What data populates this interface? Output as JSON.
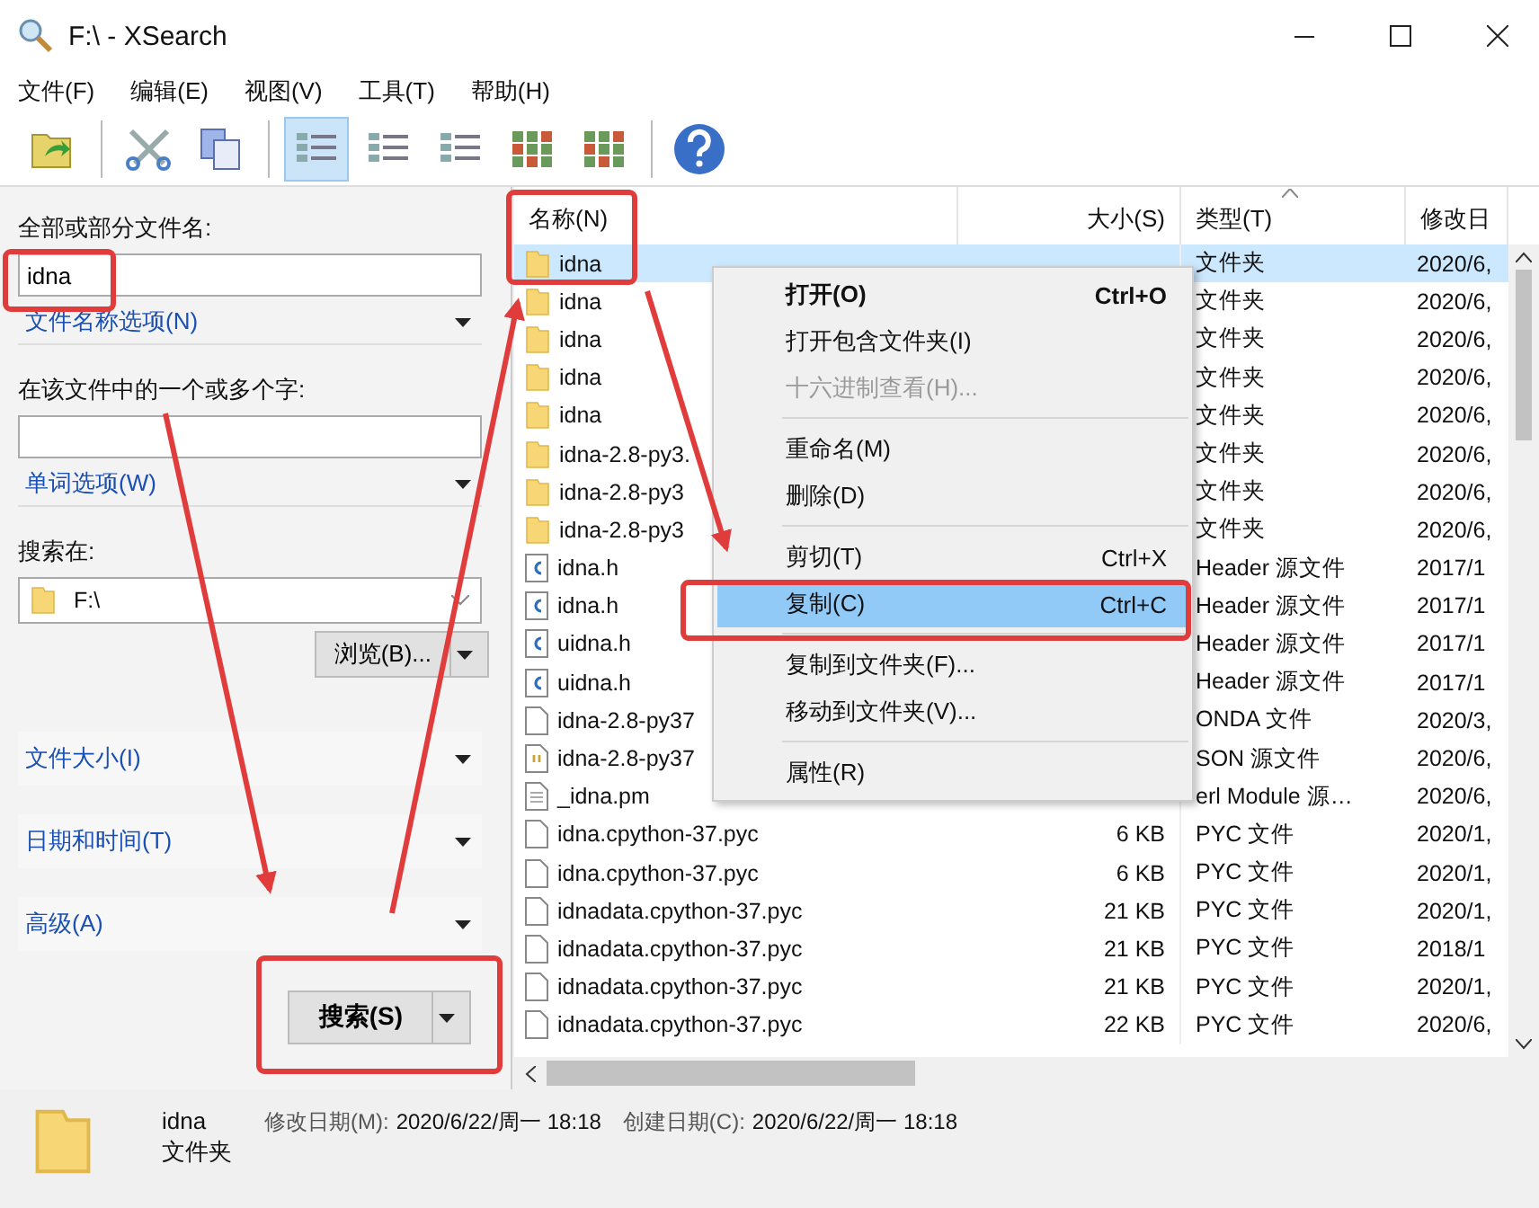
{
  "window": {
    "title": "F:\\ - XSearch"
  },
  "menu_bar": [
    "文件(F)",
    "编辑(E)",
    "视图(V)",
    "工具(T)",
    "帮助(H)"
  ],
  "toolbar": [
    {
      "kind": "open",
      "selected": false
    },
    {
      "kind": "separator"
    },
    {
      "kind": "cut",
      "selected": false
    },
    {
      "kind": "copy",
      "selected": false
    },
    {
      "kind": "separator"
    },
    {
      "kind": "details",
      "selected": true
    },
    {
      "kind": "list",
      "selected": false
    },
    {
      "kind": "tiles",
      "selected": false
    },
    {
      "kind": "icons",
      "selected": false
    },
    {
      "kind": "thumbnails",
      "selected": false
    },
    {
      "kind": "separator"
    },
    {
      "kind": "help",
      "selected": false
    }
  ],
  "search_panel": {
    "filename_label": "全部或部分文件名:",
    "filename_value": "idna",
    "filename_options": "文件名称选项(N)",
    "words_label": "在该文件中的一个或多个字:",
    "word_options": "单词选项(W)",
    "search_in_label": "搜索在:",
    "search_in_value": "F:\\",
    "browse_button": "浏览(B)...",
    "sections": [
      "文件大小(I)",
      "日期和时间(T)",
      "高级(A)"
    ],
    "search_button": "搜索(S)"
  },
  "table": {
    "columns": [
      "名称(N)",
      "大小(S)",
      "类型(T)",
      "修改日"
    ],
    "rows": [
      {
        "kind": "folder",
        "name": "idna",
        "type": "文件夹",
        "modified": "2020/6,",
        "selected": true
      },
      {
        "kind": "folder",
        "name": "idna",
        "type": "文件夹",
        "modified": "2020/6,",
        "selected": false
      },
      {
        "kind": "folder",
        "name": "idna",
        "type": "文件夹",
        "modified": "2020/6,",
        "selected": false
      },
      {
        "kind": "folder",
        "name": "idna",
        "type": "文件夹",
        "modified": "2020/6,",
        "selected": false
      },
      {
        "kind": "folder",
        "name": "idna",
        "type": "文件夹",
        "modified": "2020/6,",
        "selected": false
      },
      {
        "kind": "folder",
        "name": "idna-2.8-py3.",
        "type": "文件夹",
        "modified": "2020/6,",
        "selected": false
      },
      {
        "kind": "folder",
        "name": "idna-2.8-py3",
        "type": "文件夹",
        "modified": "2020/6,",
        "selected": false
      },
      {
        "kind": "folder",
        "name": "idna-2.8-py3",
        "type": "文件夹",
        "modified": "2020/6,",
        "selected": false
      },
      {
        "kind": "c",
        "name": "idna.h",
        "type": "Header 源文件",
        "modified": "2017/1",
        "selected": false
      },
      {
        "kind": "c",
        "name": "idna.h",
        "type": "Header 源文件",
        "modified": "2017/1",
        "selected": false
      },
      {
        "kind": "c",
        "name": "uidna.h",
        "type": "Header 源文件",
        "modified": "2017/1",
        "selected": false
      },
      {
        "kind": "c",
        "name": "uidna.h",
        "type": "Header 源文件",
        "modified": "2017/1",
        "selected": false
      },
      {
        "kind": "blank",
        "name": "idna-2.8-py37",
        "type": "ONDA 文件",
        "modified": "2020/3,",
        "selected": false
      },
      {
        "kind": "json",
        "name": "idna-2.8-py37",
        "type": "SON 源文件",
        "modified": "2020/6,",
        "selected": false
      },
      {
        "kind": "text",
        "name": "_idna.pm",
        "type": "erl Module 源…",
        "modified": "2020/6,",
        "selected": false
      },
      {
        "kind": "blank",
        "name": "idna.cpython-37.pyc",
        "size": "6 KB",
        "type": "PYC 文件",
        "modified": "2020/1,",
        "selected": false
      },
      {
        "kind": "blank",
        "name": "idna.cpython-37.pyc",
        "size": "6 KB",
        "type": "PYC 文件",
        "modified": "2020/1,",
        "selected": false
      },
      {
        "kind": "blank",
        "name": "idnadata.cpython-37.pyc",
        "size": "21 KB",
        "type": "PYC 文件",
        "modified": "2020/1,",
        "selected": false
      },
      {
        "kind": "blank",
        "name": "idnadata.cpython-37.pyc",
        "size": "21 KB",
        "type": "PYC 文件",
        "modified": "2018/1",
        "selected": false
      },
      {
        "kind": "blank",
        "name": "idnadata.cpython-37.pyc",
        "size": "21 KB",
        "type": "PYC 文件",
        "modified": "2020/1,",
        "selected": false
      },
      {
        "kind": "blank",
        "name": "idnadata.cpython-37.pyc",
        "size": "22 KB",
        "type": "PYC 文件",
        "modified": "2020/6,",
        "selected": false
      }
    ]
  },
  "context_menu": [
    {
      "kind": "item",
      "label": "打开(O)",
      "shortcut": "Ctrl+O",
      "bold": true,
      "disabled": false,
      "selected": false
    },
    {
      "kind": "item",
      "label": "打开包含文件夹(I)",
      "bold": false,
      "disabled": false,
      "selected": false
    },
    {
      "kind": "item",
      "label": "十六进制查看(H)...",
      "bold": false,
      "disabled": true,
      "selected": false
    },
    {
      "kind": "separator"
    },
    {
      "kind": "item",
      "label": "重命名(M)",
      "bold": false,
      "disabled": false,
      "selected": false
    },
    {
      "kind": "item",
      "label": "删除(D)",
      "bold": false,
      "disabled": false,
      "selected": false
    },
    {
      "kind": "separator"
    },
    {
      "kind": "item",
      "label": "剪切(T)",
      "shortcut": "Ctrl+X",
      "bold": false,
      "disabled": false,
      "selected": false
    },
    {
      "kind": "item",
      "label": "复制(C)",
      "shortcut": "Ctrl+C",
      "bold": false,
      "disabled": false,
      "selected": true
    },
    {
      "kind": "separator"
    },
    {
      "kind": "item",
      "label": "复制到文件夹(F)...",
      "bold": false,
      "disabled": false,
      "selected": false
    },
    {
      "kind": "item",
      "label": "移动到文件夹(V)...",
      "bold": false,
      "disabled": false,
      "selected": false
    },
    {
      "kind": "separator"
    },
    {
      "kind": "item",
      "label": "属性(R)",
      "bold": false,
      "disabled": false,
      "selected": false
    }
  ],
  "status_bar": {
    "name": "idna",
    "type": "文件夹",
    "modified_label": "修改日期(M):",
    "modified_value": "2020/6/22/周一 18:18",
    "created_label": "创建日期(C):",
    "created_value": "2020/6/22/周一 18:18"
  }
}
